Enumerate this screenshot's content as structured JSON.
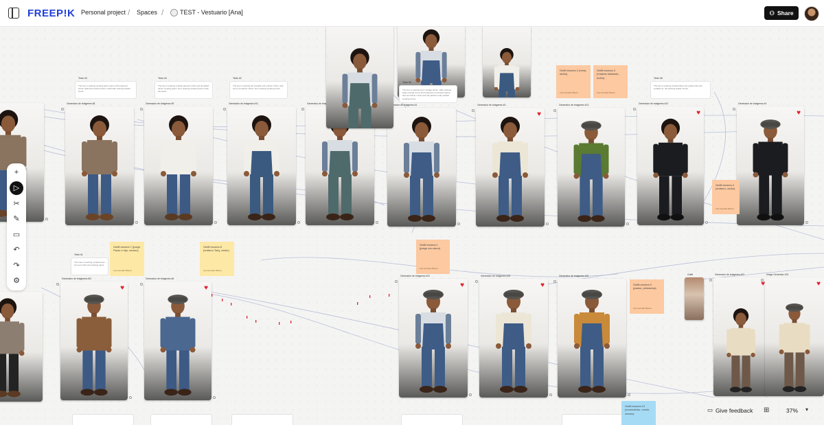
{
  "header": {
    "logo": "FREEP!K",
    "breadcrumb": [
      "Personal project",
      "Spaces",
      "TEST - Vestuario [Ana]"
    ],
    "share_label": "Share",
    "sidebar_icon": "sidebar-toggle-icon",
    "share_icon": "user-plus-icon"
  },
  "toolbar": {
    "tools": [
      "plus-icon",
      "cursor-icon",
      "scissors-icon",
      "pen-icon",
      "comment-icon",
      "undo-icon",
      "redo-icon",
      "settings-icon"
    ],
    "active": "cursor-icon",
    "glyphs": [
      "+",
      "▷",
      "✂",
      "✎",
      "▭",
      "↶",
      "↷",
      "⚙"
    ]
  },
  "footer": {
    "feedback_label": "Give feedback",
    "zoom": "37%",
    "map_icon": "map-icon",
    "feedback_icon": "comment-icon"
  },
  "colors": {
    "brand": "#1f3fd8",
    "heart": "#e02030",
    "sticky_orange": "#fcc9a1",
    "sticky_yellow": "#fde8a6",
    "sticky_blue": "#a6dbf5"
  },
  "canvas": {
    "image_nodes": [
      {
        "label": "Generador de imágenes #8",
        "cap": "",
        "liked": false
      },
      {
        "label": "Generador de imágenes #9",
        "cap": "",
        "liked": false
      },
      {
        "label": "Generador de imágenes #11",
        "cap": "",
        "liked": false
      },
      {
        "label": "Generador de imágenes #10",
        "cap": "",
        "liked": false
      },
      {
        "label": "Generador de imágenes #1",
        "cap": "",
        "liked": false
      },
      {
        "label": "Generador de imágenes #3",
        "cap": "",
        "liked": true
      },
      {
        "label": "Generador de imágenes #13",
        "cap": "",
        "liked": false
      },
      {
        "label": "Generador de imágenes #12",
        "cap": "",
        "liked": true
      },
      {
        "label": "Generador de imágenes #4",
        "cap": "",
        "liked": true
      },
      {
        "label": "Generador de imágenes #20",
        "cap": "",
        "liked": true
      },
      {
        "label": "Generador de imágenes #6",
        "cap": "",
        "liked": true
      },
      {
        "label": "Generador de imágenes #21",
        "cap": "",
        "liked": true
      },
      {
        "label": "Generador de imágenes #18",
        "cap": "",
        "liked": true
      },
      {
        "label": "Generador de imágenes #19",
        "cap": "",
        "liked": false
      },
      {
        "label": "Generador de imágenes #22",
        "cap": "",
        "liked": true
      },
      {
        "label": "Image Generator #23",
        "cap": "",
        "liked": true
      },
      {
        "label": "Image Generator #24",
        "cap": "",
        "liked": false
      }
    ],
    "text_nodes": [
      {
        "title": "Texto #3",
        "body": "The boy is wearing working jeans and a short-sleeved brown plaid shirt tucked under a with little working leather boots."
      },
      {
        "title": "Texto #4",
        "body": "The boy is wearing a white-sleeved t-shirt and old faded denim working jeans. He's wearing working boots under the jeans."
      },
      {
        "title": "Texto #2",
        "body": "The boy is wearing old overalls and a white T-shirt, with worn out leather shoes. He's wearing working boots."
      },
      {
        "title": "Texto #6",
        "body": "The boy is wearing worn vintage denim, wide working bags overalls and a short-sleeved, horizontal striped blue and white T-shirt and old patched, fully scuffed working shoes."
      },
      {
        "title": "Texto #8",
        "body": "The boy is wearing a black black suit, jacket shirt and suitable tie, old working leather shoes."
      },
      {
        "title": "Texto #1",
        "body": "The man is wearing a plaid brown worn-out shirt and working pants."
      }
    ],
    "stickies": [
      {
        "text": "Outfit escena 2 (mina, otoño)",
        "author": "Ana González Blanco",
        "color": "orange"
      },
      {
        "text": "Outfit escena 3 (madres trabando, otoño)",
        "author": "Ana González Blanco",
        "color": "orange"
      },
      {
        "text": "Outfit escena 4 (entierro, otoño)",
        "author": "Ana González Blanco",
        "color": "orange"
      },
      {
        "text": "Outfit escena 7 (juego Paolo e hijo, verano)",
        "author": "Ana González Blanco",
        "color": "yellow"
      },
      {
        "text": "Outfit escena 8 (entierro Toby, otoño)",
        "author": "Ana González Blanco",
        "color": "yellow"
      },
      {
        "text": "Outfit escena 1 (juego con amor)",
        "author": "Ana González Blanco",
        "color": "orange"
      },
      {
        "text": "Outfit escena 9 (paseo, primavera)",
        "author": "Ana González Blanco",
        "color": "orange"
      },
      {
        "text": "Outfit escena 10 (encendedor, noche, verano)",
        "author": "",
        "color": "blue"
      }
    ],
    "outfit_label": "Outfit"
  }
}
